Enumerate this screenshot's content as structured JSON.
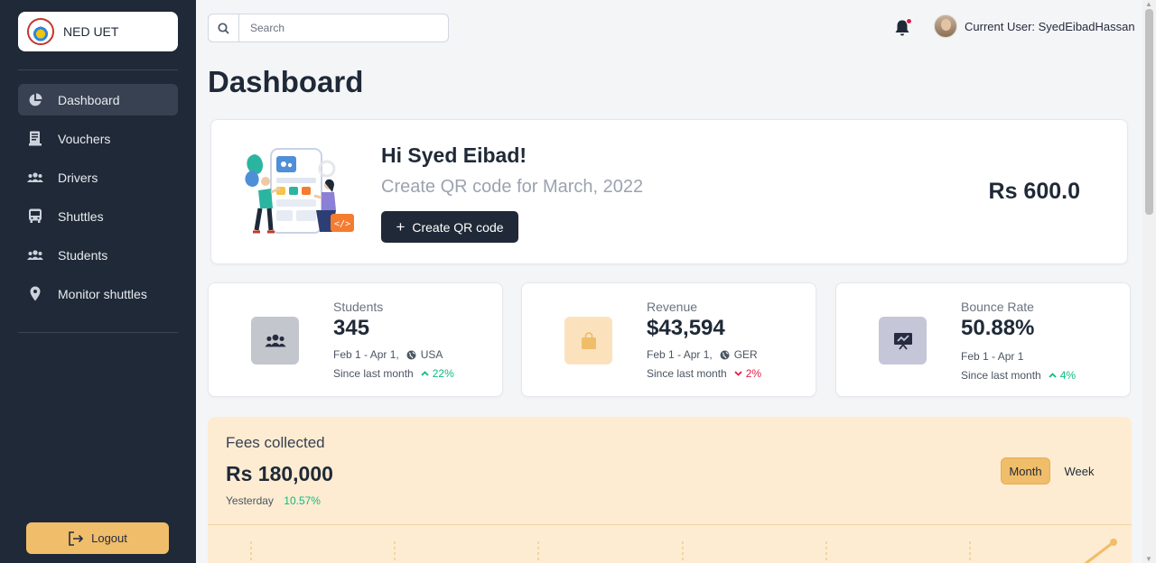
{
  "brand": {
    "name": "NED UET"
  },
  "sidebar": {
    "items": [
      {
        "label": "Dashboard",
        "icon": "pie-chart-icon",
        "active": true
      },
      {
        "label": "Vouchers",
        "icon": "receipt-icon"
      },
      {
        "label": "Drivers",
        "icon": "users-icon"
      },
      {
        "label": "Shuttles",
        "icon": "bus-icon"
      },
      {
        "label": "Students",
        "icon": "users-icon"
      },
      {
        "label": "Monitor shuttles",
        "icon": "location-pin-icon"
      }
    ],
    "logout_label": "Logout"
  },
  "topbar": {
    "search_placeholder": "Search",
    "user_label": "Current User: SyedEibadHassan"
  },
  "page": {
    "title": "Dashboard"
  },
  "hero": {
    "greeting": "Hi Syed Eibad!",
    "subtitle": "Create QR code for March, 2022",
    "button_label": "Create QR code",
    "amount": "Rs 600.0"
  },
  "stats": [
    {
      "title": "Students",
      "value": "345",
      "range": "Feb 1 - Apr 1,",
      "region": "USA",
      "since": "Since last month",
      "delta": "22%",
      "direction": "up",
      "icon": "users-icon",
      "icon_bg": "#c3c6cc",
      "icon_color": "#262b40"
    },
    {
      "title": "Revenue",
      "value": "$43,594",
      "range": "Feb 1 - Apr 1,",
      "region": "GER",
      "since": "Since last month",
      "delta": "2%",
      "direction": "down",
      "icon": "shopping-bag-icon",
      "icon_bg": "#fbe2bd",
      "icon_color": "#f0bd6a"
    },
    {
      "title": "Bounce Rate",
      "value": "50.88%",
      "range": "Feb 1 - Apr 1",
      "region": "",
      "since": "Since last month",
      "delta": "4%",
      "direction": "up",
      "icon": "presentation-chart-icon",
      "icon_bg": "#c5c6d8",
      "icon_color": "#262b40"
    }
  ],
  "fees": {
    "title": "Fees collected",
    "value": "Rs 180,000",
    "yesterday_label": "Yesterday",
    "yesterday_delta": "10.57%",
    "toggle_month": "Month",
    "toggle_week": "Week"
  },
  "colors": {
    "sidebar_bg": "#1f2937",
    "accent": "#f0bd6a",
    "positive": "#10b981",
    "negative": "#e11d48"
  }
}
